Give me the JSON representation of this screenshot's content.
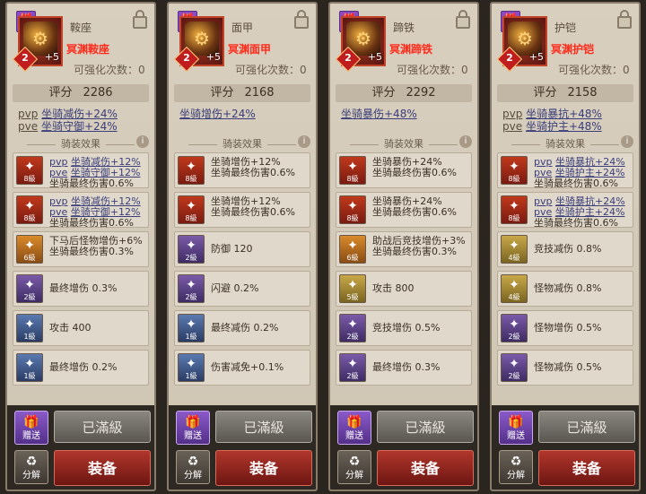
{
  "panels": [
    {
      "slot": "鞍座",
      "item_name": "冥渊鞍座",
      "level": "2",
      "plus": "+5",
      "enhance": "可强化次数：0",
      "score_label": "评分",
      "score": "2286",
      "bonus": [
        {
          "prefix": "pvp",
          "text": "坐骑减伤+24%"
        },
        {
          "prefix": "pve",
          "text": "坐骑守御+24%"
        }
      ],
      "riding_title": "骑装效果",
      "effects": [
        {
          "color": "red",
          "grade": "8級",
          "lines": [
            {
              "pre": "pvp",
              "txt": "坐骑减伤+12%"
            },
            {
              "pre": "pve",
              "txt": "坐骑守御+12%"
            },
            {
              "pre": "",
              "txt": "坐骑最终伤害0.6%"
            }
          ]
        },
        {
          "color": "red",
          "grade": "8級",
          "lines": [
            {
              "pre": "pvp",
              "txt": "坐骑减伤+12%"
            },
            {
              "pre": "pve",
              "txt": "坐骑守御+12%"
            },
            {
              "pre": "",
              "txt": "坐骑最终伤害0.6%"
            }
          ]
        },
        {
          "color": "orange",
          "grade": "6級",
          "lines": [
            {
              "pre": "",
              "txt": "下马后怪物增伤+6%"
            },
            {
              "pre": "",
              "txt": "坐骑最终伤害0.3%"
            }
          ]
        },
        {
          "color": "purple",
          "grade": "2級",
          "lines": [
            {
              "pre": "",
              "txt": "最终增伤 0.3%"
            }
          ]
        },
        {
          "color": "blue",
          "grade": "1級",
          "lines": [
            {
              "pre": "",
              "txt": "攻击 400"
            }
          ]
        },
        {
          "color": "blue",
          "grade": "1級",
          "lines": [
            {
              "pre": "",
              "txt": "最终增伤 0.2%"
            }
          ]
        }
      ],
      "gift_label": "赠送",
      "decompose_label": "分解",
      "maxed_label": "已滿級",
      "equip_label": "装备"
    },
    {
      "slot": "面甲",
      "item_name": "冥渊面甲",
      "level": "2",
      "plus": "+5",
      "enhance": "可强化次数：0",
      "score_label": "评分",
      "score": "2168",
      "bonus": [
        {
          "prefix": "",
          "text": "坐骑增伤+24%"
        }
      ],
      "riding_title": "骑装效果",
      "effects": [
        {
          "color": "red",
          "grade": "8級",
          "lines": [
            {
              "pre": "",
              "txt": "坐骑增伤+12%"
            },
            {
              "pre": "",
              "txt": "坐骑最终伤害0.6%"
            }
          ]
        },
        {
          "color": "red",
          "grade": "8級",
          "lines": [
            {
              "pre": "",
              "txt": "坐骑增伤+12%"
            },
            {
              "pre": "",
              "txt": "坐骑最终伤害0.6%"
            }
          ]
        },
        {
          "color": "purple",
          "grade": "2級",
          "lines": [
            {
              "pre": "",
              "txt": "防御 120"
            }
          ]
        },
        {
          "color": "purple",
          "grade": "2級",
          "lines": [
            {
              "pre": "",
              "txt": "闪避 0.2%"
            }
          ]
        },
        {
          "color": "blue",
          "grade": "1級",
          "lines": [
            {
              "pre": "",
              "txt": "最终减伤 0.2%"
            }
          ]
        },
        {
          "color": "blue",
          "grade": "1級",
          "lines": [
            {
              "pre": "",
              "txt": "伤害减免+0.1%"
            }
          ]
        }
      ],
      "gift_label": "赠送",
      "decompose_label": "分解",
      "maxed_label": "已滿級",
      "equip_label": "装备"
    },
    {
      "slot": "蹄铁",
      "item_name": "冥渊蹄铁",
      "level": "2",
      "plus": "+5",
      "enhance": "可强化次数：0",
      "score_label": "评分",
      "score": "2292",
      "bonus": [
        {
          "prefix": "",
          "text": "坐骑暴伤+48%"
        }
      ],
      "riding_title": "骑装效果",
      "effects": [
        {
          "color": "red",
          "grade": "8級",
          "lines": [
            {
              "pre": "",
              "txt": "坐骑暴伤+24%"
            },
            {
              "pre": "",
              "txt": "坐骑最终伤害0.6%"
            }
          ]
        },
        {
          "color": "red",
          "grade": "8級",
          "lines": [
            {
              "pre": "",
              "txt": "坐骑暴伤+24%"
            },
            {
              "pre": "",
              "txt": "坐骑最终伤害0.6%"
            }
          ]
        },
        {
          "color": "orange",
          "grade": "6級",
          "lines": [
            {
              "pre": "",
              "txt": "助战后竞技增伤+3%"
            },
            {
              "pre": "",
              "txt": "坐骑最终伤害0.3%"
            }
          ]
        },
        {
          "color": "gold",
          "grade": "5級",
          "lines": [
            {
              "pre": "",
              "txt": "攻击 800"
            }
          ]
        },
        {
          "color": "purple",
          "grade": "2級",
          "lines": [
            {
              "pre": "",
              "txt": "竞技增伤 0.5%"
            }
          ]
        },
        {
          "color": "purple",
          "grade": "2級",
          "lines": [
            {
              "pre": "",
              "txt": "最终增伤 0.3%"
            }
          ]
        }
      ],
      "gift_label": "赠送",
      "decompose_label": "分解",
      "maxed_label": "已滿級",
      "equip_label": "装备"
    },
    {
      "slot": "护铠",
      "item_name": "冥渊护铠",
      "level": "2",
      "plus": "+5",
      "enhance": "可强化次数：0",
      "score_label": "评分",
      "score": "2158",
      "bonus": [
        {
          "prefix": "pvp",
          "text": "坐骑暴抗+48%"
        },
        {
          "prefix": "pve",
          "text": "坐骑护主+48%"
        }
      ],
      "riding_title": "骑装效果",
      "effects": [
        {
          "color": "red",
          "grade": "8級",
          "lines": [
            {
              "pre": "pvp",
              "txt": "坐骑暴抗+24%"
            },
            {
              "pre": "pve",
              "txt": "坐骑护主+24%"
            },
            {
              "pre": "",
              "txt": "坐骑最终伤害0.6%"
            }
          ]
        },
        {
          "color": "red",
          "grade": "8級",
          "lines": [
            {
              "pre": "pvp",
              "txt": "坐骑暴抗+24%"
            },
            {
              "pre": "pve",
              "txt": "坐骑护主+24%"
            },
            {
              "pre": "",
              "txt": "坐骑最终伤害0.6%"
            }
          ]
        },
        {
          "color": "gold",
          "grade": "4級",
          "lines": [
            {
              "pre": "",
              "txt": "竞技减伤 0.8%"
            }
          ]
        },
        {
          "color": "gold",
          "grade": "4級",
          "lines": [
            {
              "pre": "",
              "txt": "怪物减伤 0.8%"
            }
          ]
        },
        {
          "color": "purple",
          "grade": "2級",
          "lines": [
            {
              "pre": "",
              "txt": "怪物增伤 0.5%"
            }
          ]
        },
        {
          "color": "purple",
          "grade": "2級",
          "lines": [
            {
              "pre": "",
              "txt": "怪物减伤 0.5%"
            }
          ]
        }
      ],
      "gift_label": "赠送",
      "decompose_label": "分解",
      "maxed_label": "已滿級",
      "equip_label": "装备"
    }
  ]
}
